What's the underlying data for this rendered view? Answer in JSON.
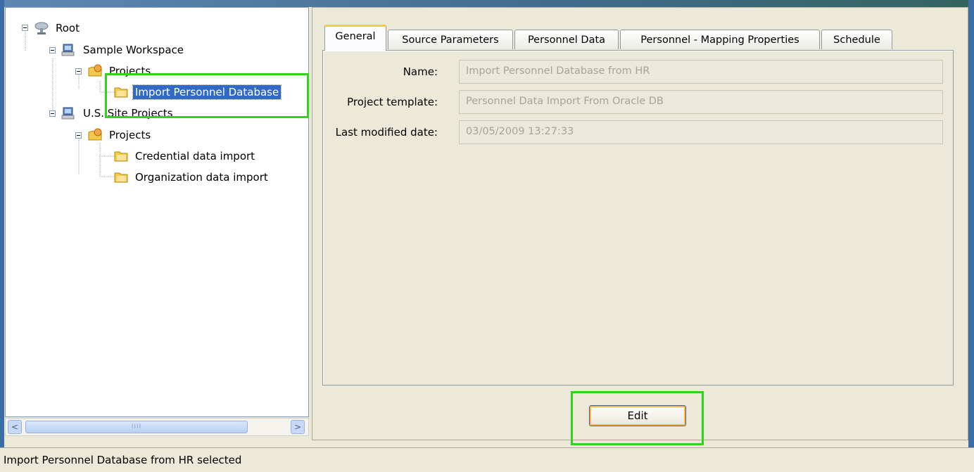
{
  "tree": {
    "nodes": [
      {
        "label": "Root",
        "icon": "root-network-icon"
      },
      {
        "label": "Sample Workspace",
        "icon": "workspace-computer-icon"
      },
      {
        "label": "Projects",
        "icon": "projects-folder-icon"
      },
      {
        "label": "Import Personnel Database",
        "icon": "project-folder-icon"
      },
      {
        "label": "U.S. Site Projects",
        "icon": "workspace-computer-icon"
      },
      {
        "label": "Projects",
        "icon": "projects-folder-icon"
      },
      {
        "label": "Credential data import",
        "icon": "project-folder-icon"
      },
      {
        "label": "Organization data import",
        "icon": "project-folder-icon"
      }
    ],
    "selected_label": "Import Personnel Database"
  },
  "scrollbar": {
    "left_arrow": "<",
    "right_arrow": ">",
    "grip": "IIII"
  },
  "tabs": [
    {
      "label": "General",
      "active": true
    },
    {
      "label": "Source Parameters",
      "active": false
    },
    {
      "label": "Personnel Data",
      "active": false
    },
    {
      "label": "Personnel - Mapping Properties",
      "active": false
    },
    {
      "label": "Schedule",
      "active": false
    }
  ],
  "general": {
    "fields": [
      {
        "label": "Name:",
        "value": "Import Personnel Database from HR"
      },
      {
        "label": "Project template:",
        "value": "Personnel Data Import From Oracle DB"
      },
      {
        "label": "Last modified date:",
        "value": "03/05/2009 13:27:33"
      }
    ]
  },
  "actions": {
    "edit_label": "Edit"
  },
  "status_bar": {
    "text": "Import Personnel Database from HR selected"
  },
  "colors": {
    "selection": "#316ac5",
    "highlight_box": "#2ed51a",
    "active_tab_accent": "#ffc83c"
  }
}
